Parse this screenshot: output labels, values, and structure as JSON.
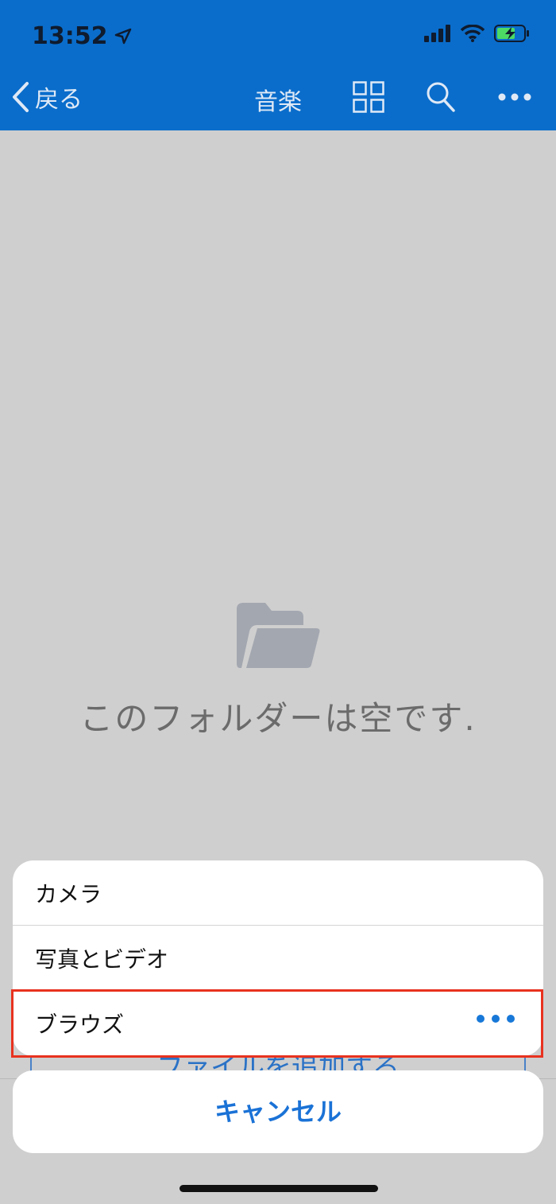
{
  "status": {
    "time": "13:52"
  },
  "nav": {
    "back_label": "戻る",
    "title": "音楽"
  },
  "empty": {
    "message": "このフォルダーは空です."
  },
  "add_file_label": "ファイルを追加する",
  "sheet": {
    "items": [
      {
        "label": "カメラ"
      },
      {
        "label": "写真とビデオ"
      },
      {
        "label": "ブラウズ"
      }
    ],
    "cancel_label": "キャンセル"
  },
  "icons": {
    "back": "chevron-left-icon",
    "grid": "grid-view-icon",
    "search": "search-icon",
    "more": "more-icon",
    "folder": "folder-icon",
    "location": "location-arrow-icon",
    "signal": "cellular-signal-icon",
    "wifi": "wifi-icon",
    "battery": "battery-charging-icon"
  },
  "colors": {
    "header": "#0a6dcb",
    "accent": "#1a72d6",
    "highlight": "#e8321f",
    "battery_fill": "#4cd964"
  }
}
